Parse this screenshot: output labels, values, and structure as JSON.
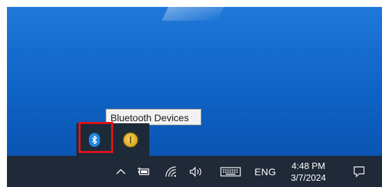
{
  "tooltip": {
    "text": "Bluetooth Devices"
  },
  "tray_overflow": {
    "items": [
      {
        "icon": "bluetooth-icon",
        "label": "Bluetooth Devices"
      },
      {
        "icon": "security-shield-icon",
        "label": ""
      }
    ]
  },
  "taskbar": {
    "system_tray": {
      "icons": [
        "chevron-up-icon",
        "battery-icon",
        "wifi-icon",
        "volume-icon",
        "keyboard-icon"
      ],
      "language": "ENG",
      "time": "4:48 PM",
      "date": "3/7/2024",
      "notification_icon": "action-center-icon"
    }
  },
  "colors": {
    "desktop": "#1672d4",
    "taskbar": "#1f2937",
    "highlight": "#e0141a",
    "bluetooth": "#1e88e5"
  }
}
